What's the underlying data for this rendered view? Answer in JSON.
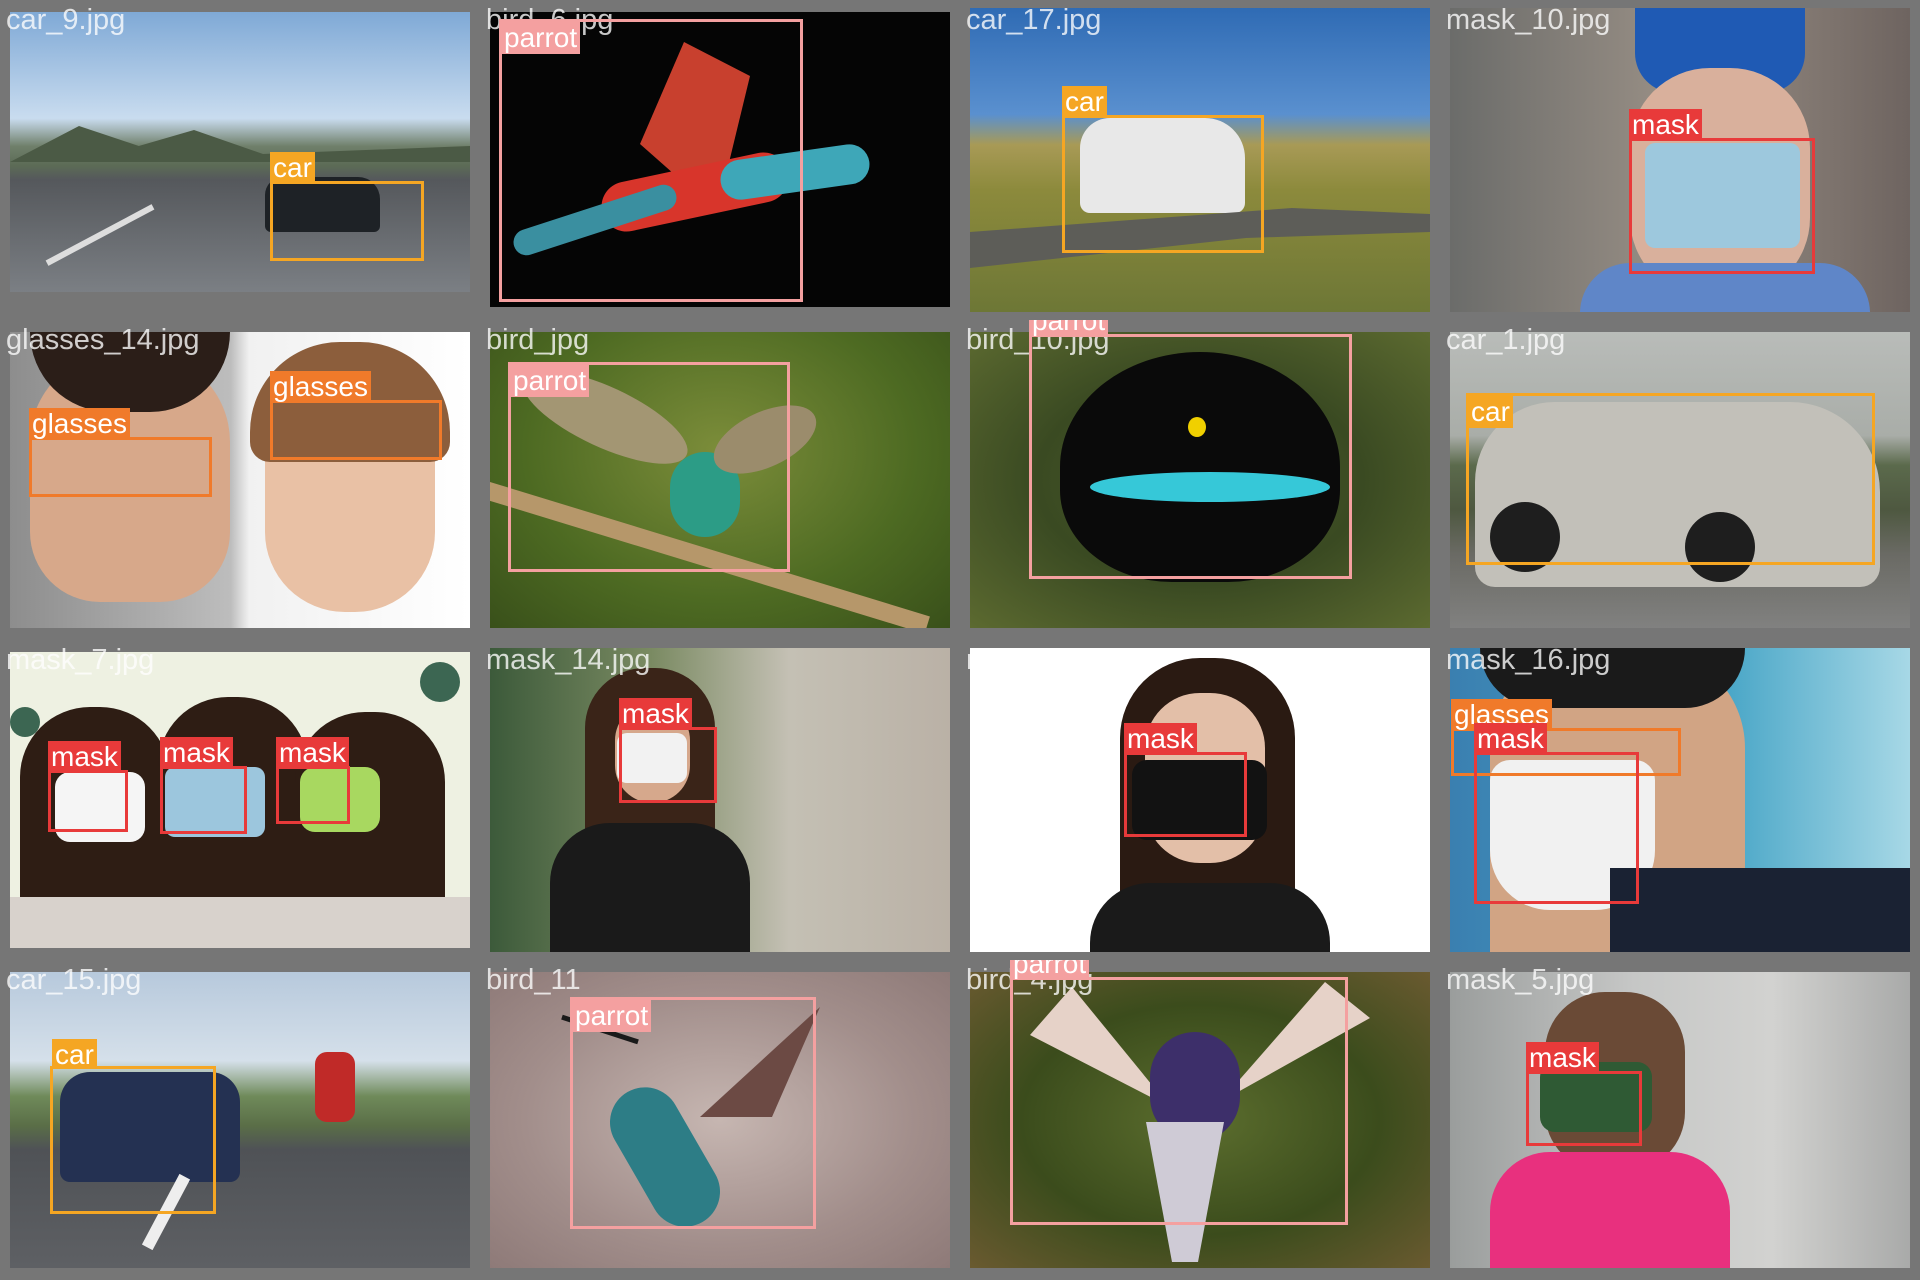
{
  "class_colors": {
    "car": "#f5a623",
    "parrot": "#f4a0a0",
    "mask": "#e83a3a",
    "glasses": "#f07a2a"
  },
  "tiles": [
    {
      "filename": "car_9.jpg",
      "detections": [
        {
          "label": "car"
        }
      ]
    },
    {
      "filename": "bird_6.jpg",
      "detections": [
        {
          "label": "parrot"
        }
      ]
    },
    {
      "filename": "car_17.jpg",
      "detections": [
        {
          "label": "car"
        }
      ]
    },
    {
      "filename": "mask_10.jpg",
      "detections": [
        {
          "label": "mask"
        }
      ]
    },
    {
      "filename": "glasses_14.jpg",
      "detections": [
        {
          "label": "glasses"
        },
        {
          "label": "glasses"
        }
      ]
    },
    {
      "filename": "bird_jpg",
      "detections": [
        {
          "label": "parrot"
        }
      ]
    },
    {
      "filename": "bird_10.jpg",
      "detections": [
        {
          "label": "parrot"
        }
      ]
    },
    {
      "filename": "car_1.jpg",
      "detections": [
        {
          "label": "car"
        }
      ]
    },
    {
      "filename": "mask_7.jpg",
      "detections": [
        {
          "label": "mask"
        },
        {
          "label": "mask"
        },
        {
          "label": "mask"
        }
      ]
    },
    {
      "filename": "mask_14.jpg",
      "detections": [
        {
          "label": "mask"
        }
      ]
    },
    {
      "filename": "mask_11.jpg",
      "detections": [
        {
          "label": "mask"
        }
      ]
    },
    {
      "filename": "mask_16.jpg",
      "detections": [
        {
          "label": "glasses"
        },
        {
          "label": "mask"
        }
      ]
    },
    {
      "filename": "car_15.jpg",
      "detections": [
        {
          "label": "car"
        }
      ]
    },
    {
      "filename": "bird_11",
      "detections": [
        {
          "label": "parrot"
        }
      ]
    },
    {
      "filename": "bird_4.jpg",
      "detections": [
        {
          "label": "parrot"
        }
      ]
    },
    {
      "filename": "mask_5.jpg",
      "detections": [
        {
          "label": "mask"
        }
      ]
    }
  ]
}
